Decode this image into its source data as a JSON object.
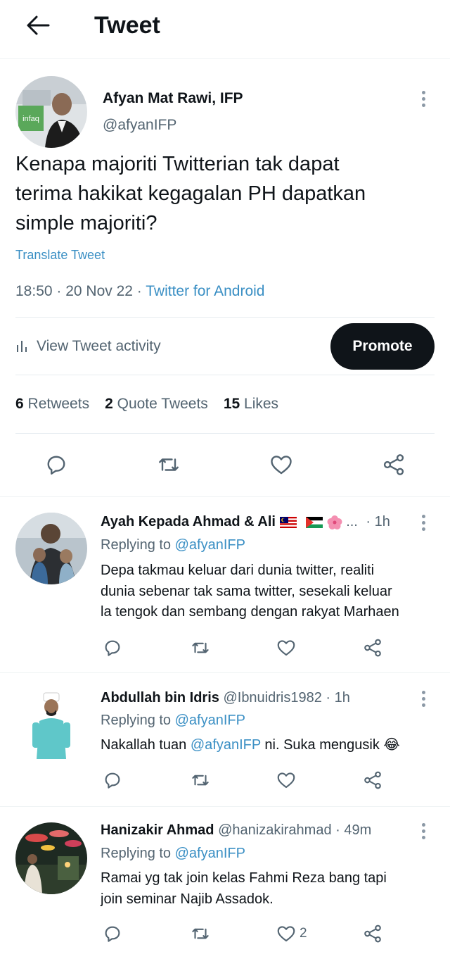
{
  "header": {
    "title": "Tweet"
  },
  "tweet": {
    "author_name": "Afyan Mat Rawi, IFP",
    "handle": "@afyanIFP",
    "text": "Kenapa majoriti Twitterian tak dapat\nterima hakikat kegagalan PH dapatkan\nsimple majoriti?",
    "translate_label": "Translate Tweet",
    "time": "18:50 · 20 Nov 22 · ",
    "source": "Twitter for Android",
    "activity_label": "View Tweet activity",
    "promote_label": "Promote",
    "stats": {
      "retweets_count": "6",
      "retweets_label": "Retweets",
      "quotes_count": "2",
      "quotes_label": "Quote Tweets",
      "likes_count": "15",
      "likes_label": "Likes"
    },
    "avatar_badge_text": "infaq"
  },
  "replies": [
    {
      "name": "Ayah Kepada Ahmad & Ali",
      "handle": "",
      "name_suffix": "...",
      "time": "· 1h",
      "replying_label": "Replying to ",
      "replying_to": "@afyanIFP",
      "text": "Depa takmau keluar dari dunia twitter, realiti\ndunia sebenar tak sama twitter, sesekali keluar\nla tengok dan sembang dengan rakyat Marhaen",
      "like_count": ""
    },
    {
      "name": "Abdullah bin Idris",
      "handle": "@Ibnuidris1982",
      "time": "· 1h",
      "replying_label": "Replying to ",
      "replying_to": "@afyanIFP",
      "text_before": "Nakallah tuan ",
      "text_mention": "@afyanIFP",
      "text_after": " ni. Suka mengusik ",
      "emoji": "😂",
      "like_count": ""
    },
    {
      "name": "Hanizakir Ahmad",
      "handle": "@hanizakirahmad",
      "time": "· 49m",
      "replying_label": "Replying to ",
      "replying_to": "@afyanIFP",
      "text": "Ramai yg tak join kelas Fahmi Reza bang tapi\njoin seminar Najib Assadok.",
      "like_count": "2"
    }
  ],
  "colors": {
    "link": "#3a8fc4",
    "secondary": "#536471",
    "primary": "#0f1419",
    "promote_bg": "#0f1419"
  },
  "icons": [
    "back-arrow-icon",
    "more-vertical-icon",
    "bar-chart-icon",
    "reply-icon",
    "retweet-icon",
    "heart-icon",
    "share-icon"
  ]
}
